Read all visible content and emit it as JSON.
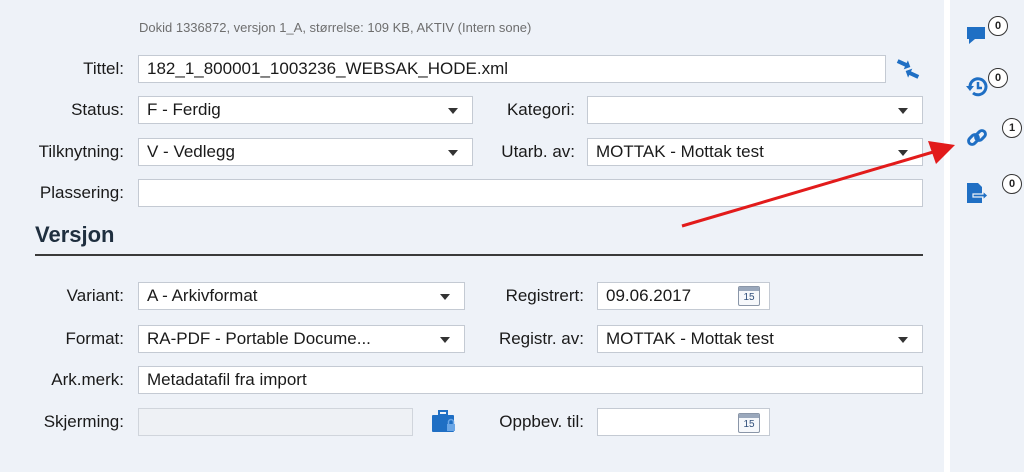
{
  "doc_info": "Dokid 1336872, versjon 1_A, størrelse: 109 KB, AKTIV (Intern sone)",
  "fields": {
    "tittel": {
      "label": "Tittel:",
      "value": "182_1_800001_1003236_WEBSAK_HODE.xml"
    },
    "status": {
      "label": "Status:",
      "value": "F - Ferdig"
    },
    "kategori": {
      "label": "Kategori:",
      "value": ""
    },
    "tilknytning": {
      "label": "Tilknytning:",
      "value": "V - Vedlegg"
    },
    "utarb_av": {
      "label": "Utarb. av:",
      "value": "MOTTAK - Mottak test"
    },
    "plassering": {
      "label": "Plassering:",
      "value": ""
    }
  },
  "versjon": {
    "heading": "Versjon",
    "variant": {
      "label": "Variant:",
      "value": "A - Arkivformat"
    },
    "registrert": {
      "label": "Registrert:",
      "value": "09.06.2017"
    },
    "format": {
      "label": "Format:",
      "value": "RA-PDF - Portable Docume..."
    },
    "registr_av": {
      "label": "Registr. av:",
      "value": "MOTTAK - Mottak test"
    },
    "ark_merk": {
      "label": "Ark.merk:",
      "value": "Metadatafil fra import"
    },
    "skjerming": {
      "label": "Skjerming:",
      "value": ""
    },
    "oppbev_til": {
      "label": "Oppbev. til:",
      "value": ""
    },
    "calendar_day": "15"
  },
  "sidebar": {
    "comments_count": "0",
    "history_count": "0",
    "links_count": "1",
    "export_count": "0"
  },
  "colors": {
    "accent_blue": "#1f6fc4",
    "arrow_red": "#e21b1b",
    "panel_bg": "#eef2f8"
  },
  "icons": [
    "swap-icon",
    "briefcase-lock-icon",
    "calendar-icon",
    "comment-icon",
    "history-icon",
    "link-icon",
    "export-icon"
  ]
}
